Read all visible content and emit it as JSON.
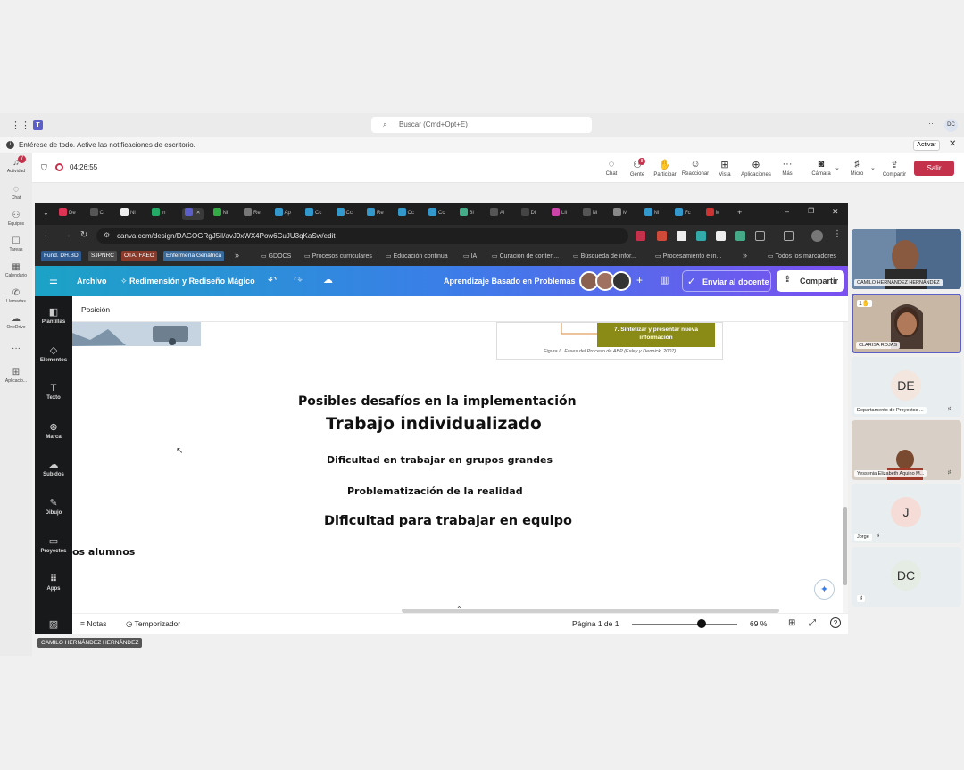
{
  "teams": {
    "search_placeholder": "Buscar (Cmd+Opt+E)",
    "notification": "Entérese de todo. Active las notificaciones de escritorio.",
    "activate": "Activar",
    "user_initials": "DC",
    "rail": [
      {
        "label": "Actividad",
        "icon": "bell-icon",
        "badge": "7"
      },
      {
        "label": "Chat",
        "icon": "chat-icon"
      },
      {
        "label": "Equipos",
        "icon": "teams-icon"
      },
      {
        "label": "Tareas",
        "icon": "tasks-icon"
      },
      {
        "label": "Calendario",
        "icon": "calendar-icon"
      },
      {
        "label": "Llamadas",
        "icon": "phone-icon"
      },
      {
        "label": "OneDrive",
        "icon": "cloud-icon"
      },
      {
        "label": "Aplicacio...",
        "icon": "apps-icon"
      }
    ],
    "meeting_timer": "04:26:55",
    "tools": [
      {
        "label": "Chat",
        "icon": "chat-icon"
      },
      {
        "label": "Gente",
        "icon": "people-icon",
        "badge": "8"
      },
      {
        "label": "Participar",
        "icon": "hand-icon"
      },
      {
        "label": "Reaccionar",
        "icon": "smile-icon"
      },
      {
        "label": "Vista",
        "icon": "grid-icon"
      },
      {
        "label": "Aplicaciones",
        "icon": "plus-icon"
      },
      {
        "label": "Más",
        "icon": "more-icon"
      },
      {
        "label": "Cámara",
        "icon": "camera-off-icon"
      },
      {
        "label": "Micro",
        "icon": "mic-off-icon"
      },
      {
        "label": "Compartir",
        "icon": "share-icon"
      }
    ],
    "leave": "Salir"
  },
  "browser": {
    "url": "canva.com/design/DAGOGRgJ5iI/avJ9xWX4Pow6CuJU3qKaSw/edit",
    "tabs": [
      "De",
      "Cl",
      "Ni",
      "In",
      "",
      "Ni",
      "Re",
      "Ap",
      "Cc",
      "Cc",
      "Re",
      "Cc",
      "Cc",
      "Bi",
      "Al",
      "Di",
      "Lli",
      "Ni",
      "M",
      "Ni",
      "Fc",
      "M"
    ],
    "bookmark_tags": [
      {
        "label": "Fund. DH.BD",
        "color": "#2f5a8f"
      },
      {
        "label": "SJPNRC",
        "color": "#4a4a4a"
      },
      {
        "label": "OTA. FAEO",
        "color": "#8a3a2a"
      },
      {
        "label": "Enfermería Geriátrica",
        "color": "#3a6a9a"
      }
    ],
    "bookmarks": [
      "GDOCS",
      "Procesos curriculares",
      "Educación continua",
      "IA",
      "Curación de conten...",
      "Búsqueda de infor...",
      "Procesamiento e in..."
    ],
    "all_bookmarks": "Todos los marcadores"
  },
  "canva": {
    "file": "Archivo",
    "magic": "Redimensión y Rediseño Mágico",
    "design_title": "Aprendizaje Basado en Problemas",
    "send": "Enviar al docente",
    "share": "Compartir",
    "toolbar_label": "Posición",
    "side": [
      {
        "label": "Plantillas",
        "icon": "templates-icon"
      },
      {
        "label": "Elementos",
        "icon": "elements-icon"
      },
      {
        "label": "Texto",
        "icon": "text-icon"
      },
      {
        "label": "Marca",
        "icon": "brand-icon"
      },
      {
        "label": "Subidos",
        "icon": "upload-icon"
      },
      {
        "label": "Dibujo",
        "icon": "draw-icon"
      },
      {
        "label": "Proyectos",
        "icon": "folder-icon"
      },
      {
        "label": "Apps",
        "icon": "apps-icon"
      }
    ],
    "figure_box": "7. Sintetizar y presentar nueva información",
    "figure_caption": "Figura II. Fases del Proceso de ABP (Exley y Dennick, 2007)",
    "slide": {
      "heading": "Posibles desafíos en la implementación",
      "line1": "Trabajo individualizado",
      "line2": "Dificultad en trabajar en grupos grandes",
      "line3": "Problematización de la realidad",
      "line4": "Dificultad para trabajar en equipo",
      "partial": "os alumnos"
    },
    "footer": {
      "notes": "Notas",
      "timer": "Temporizador",
      "page": "Página 1 de 1",
      "zoom": "69 %"
    }
  },
  "presenter": "CAMILO HERNÁNDEZ HERNÁNDEZ",
  "participants": [
    {
      "name": "CAMILO HERNÁNDEZ HERNÁNDEZ",
      "type": "video"
    },
    {
      "name": "CLARISA ROJAS",
      "type": "video",
      "badge": "1"
    },
    {
      "name": "Departamento de Proyectos ...",
      "initials": "DE",
      "muted": true
    },
    {
      "name": "Yessenia Elizabeth Aquino M...",
      "type": "video",
      "muted": true
    },
    {
      "name": "Jorge",
      "initials": "J",
      "muted": true
    },
    {
      "name": "",
      "initials": "DC",
      "muted": true
    }
  ]
}
